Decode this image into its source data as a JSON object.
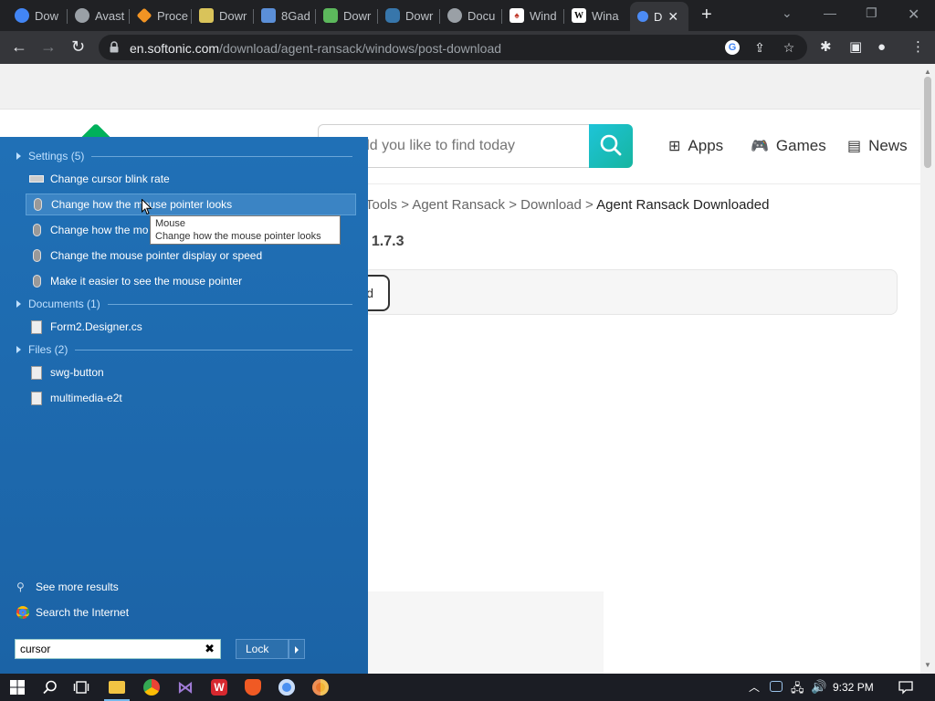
{
  "browser": {
    "tabs": [
      {
        "title": "Dow",
        "icon": "chrome-icon",
        "color": "#4285f4"
      },
      {
        "title": "Avast",
        "icon": "globe-icon",
        "color": "#9aa0a6"
      },
      {
        "title": "Proce",
        "icon": "diamond-icon",
        "color": "#f29423"
      },
      {
        "title": "Dowr",
        "icon": "notepad-icon",
        "color": "#d9c35a"
      },
      {
        "title": "8Gad",
        "icon": "monitor-icon",
        "color": "#5b8fd8"
      },
      {
        "title": "Dowr",
        "icon": "hexagon-icon",
        "color": "#5cb85c"
      },
      {
        "title": "Dowr",
        "icon": "python-icon",
        "color": "#3776ab"
      },
      {
        "title": "Docu",
        "icon": "globe-icon",
        "color": "#9aa0a6"
      },
      {
        "title": "Wind",
        "icon": "cards-icon",
        "color": "#c0392b"
      },
      {
        "title": "Wina",
        "icon": "wikipedia-icon",
        "color": "#ffffff"
      },
      {
        "title": "D",
        "icon": "softonic-icon",
        "color": "#4c8bf5"
      }
    ],
    "url_host": "en.softonic.com",
    "url_path": "/download/agent-ransack/windows/post-download"
  },
  "site": {
    "search_placeholder": "t would you like to find today",
    "nav": [
      {
        "label": "Apps",
        "icon": "apps-grid-icon"
      },
      {
        "label": "Games",
        "icon": "gamepad-icon"
      },
      {
        "label": "News",
        "icon": "news-icon"
      }
    ],
    "breadcrumb": [
      "Tools",
      "Agent Ransack",
      "Download",
      "Agent Ransack Downloaded"
    ],
    "breadcrumb_sep": ">",
    "version": "/ 1.7.3",
    "download_label": "d"
  },
  "startmenu": {
    "groups": [
      {
        "label": "Settings (5)"
      },
      {
        "label": "Documents (1)"
      },
      {
        "label": "Files (2)"
      }
    ],
    "settings_results": [
      {
        "label": "Change cursor blink rate",
        "icon": "keyboard-icon"
      },
      {
        "label": "Change how the mouse pointer looks",
        "icon": "mouse-icon"
      },
      {
        "label": "Change how the mo",
        "icon": "mouse-icon"
      },
      {
        "label": "Change the mouse pointer display or speed",
        "icon": "mouse-icon"
      },
      {
        "label": "Make it easier to see the mouse pointer",
        "icon": "mouse-icon"
      }
    ],
    "document_results": [
      {
        "label": "Form2.Designer.cs",
        "icon": "document-icon"
      }
    ],
    "file_results": [
      {
        "label": "swg-button",
        "icon": "file-icon"
      },
      {
        "label": "multimedia-e2t",
        "icon": "file-icon"
      }
    ],
    "see_more": "See more results",
    "search_internet": "Search the Internet",
    "search_value": "cursor",
    "lock_label": "Lock"
  },
  "tooltip": {
    "title": "Mouse",
    "body": "Change how the mouse pointer looks"
  },
  "taskbar": {
    "clock": "9:32 PM"
  }
}
